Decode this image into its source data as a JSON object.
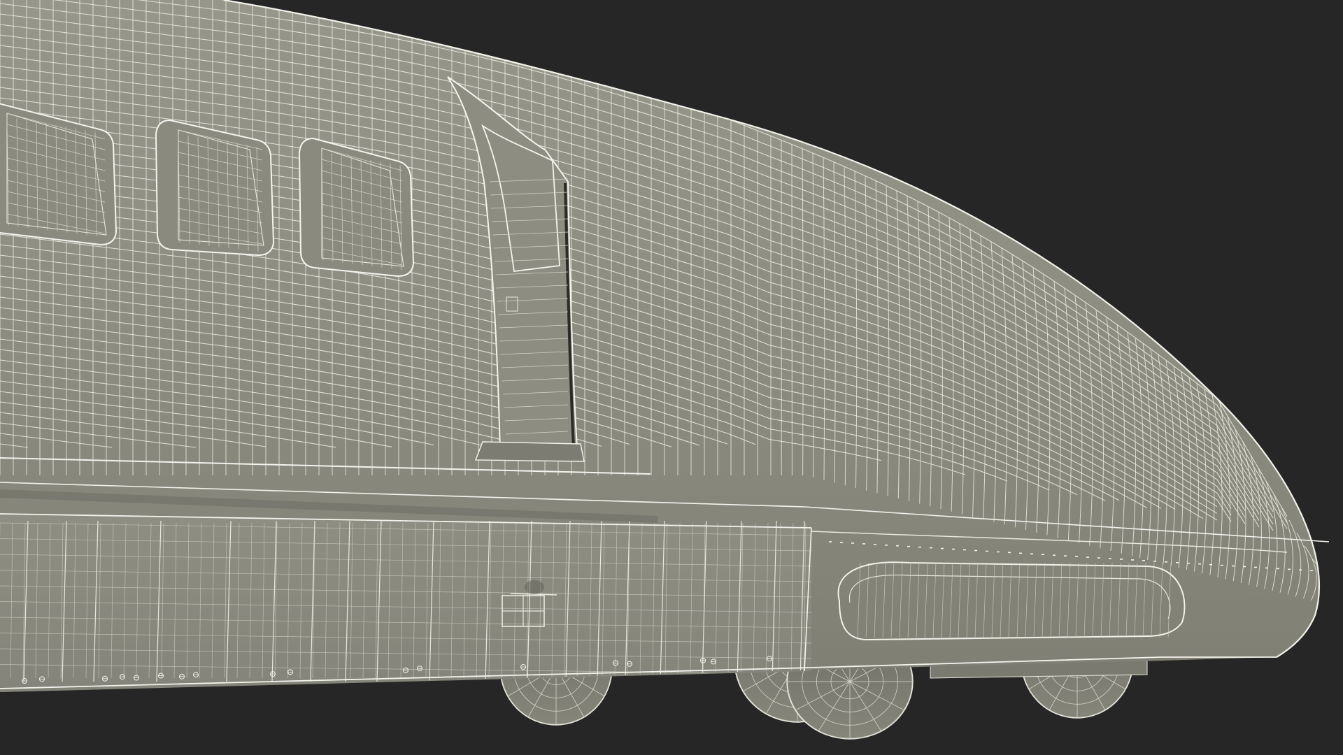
{
  "scene": {
    "subject": "bullet-train-nose",
    "render_style": "wireframe-over-shaded",
    "colors": {
      "background": "#262626",
      "body_fill": "#8c8c80",
      "body_fill_light": "#96968a",
      "body_fill_dark": "#7a7a70",
      "wire": "#e9e9df",
      "wire_soft": "#d4d4c8",
      "wheel_fill": "#7d7d72"
    }
  }
}
